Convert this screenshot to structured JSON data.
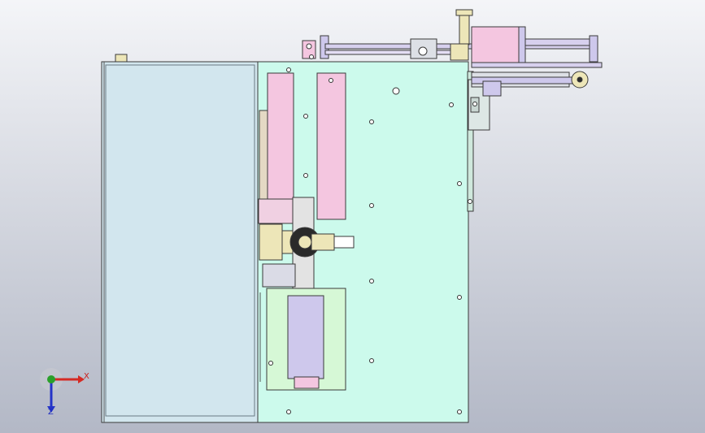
{
  "view": {
    "background_top": "#f4f5f8",
    "background_bottom": "#b3b8c6"
  },
  "model": {
    "left_panel_color": "#d2e6ee",
    "main_plate_color": "#ccfaec",
    "slide_color": "#f4c6e0",
    "motor_color": "#cec8ec",
    "lower_plate_color": "#d6f8d6",
    "brass_color": "#ede6b8",
    "dark_color": "#2a2a2a",
    "edge_color": "#3a3a3a"
  },
  "triad": {
    "x_label": "X",
    "z_label": "Z",
    "x_color": "#d52a24",
    "y_color": "#2aa02a",
    "z_color": "#2433c8"
  }
}
